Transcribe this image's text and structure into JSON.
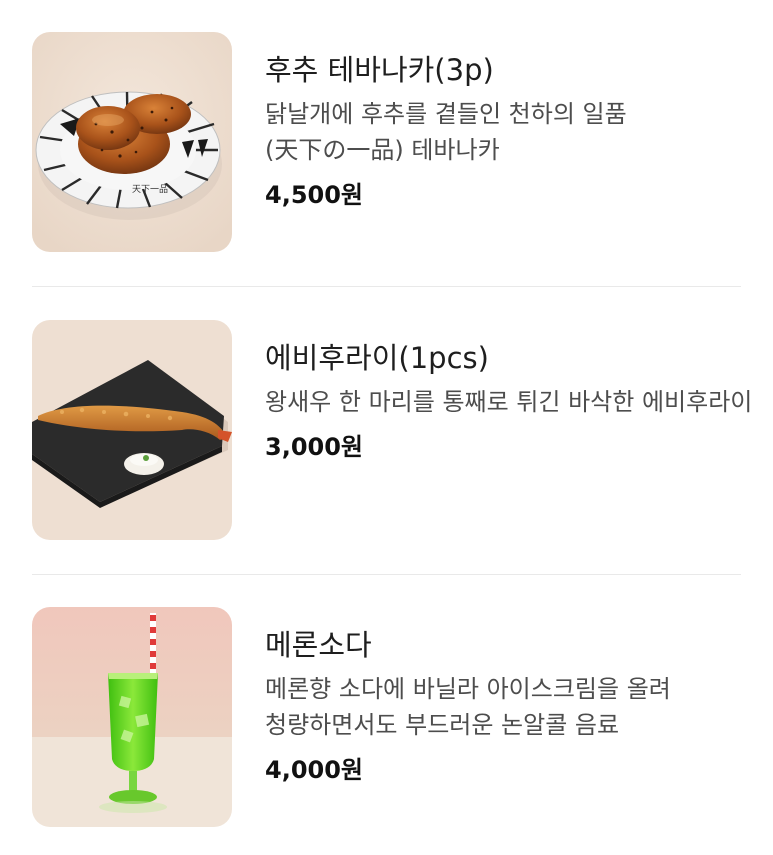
{
  "menu": {
    "items": [
      {
        "name": "후추 테바나카(3p)",
        "description": "닭날개에 후추를 곁들인 천하의 일품(天下の一品) 테바나카",
        "price": "4,500원",
        "image_icon": "fried-chicken-wings-photo",
        "plate_text": "天下一品"
      },
      {
        "name": "에비후라이(1pcs)",
        "description": "왕새우 한 마리를 통째로 튀긴 바삭한 에비후라이",
        "price": "3,000원",
        "image_icon": "fried-shrimp-photo"
      },
      {
        "name": "메론소다",
        "description": "메론향 소다에 바닐라 아이스크림을 올려 청량하면서도 부드러운 논알콜 음료",
        "price": "4,000원",
        "image_icon": "melon-soda-photo"
      }
    ]
  },
  "colors": {
    "thumb_background": "#eedfd2",
    "soda_green": "#5fd21c",
    "fried_orange": "#b8601e"
  }
}
